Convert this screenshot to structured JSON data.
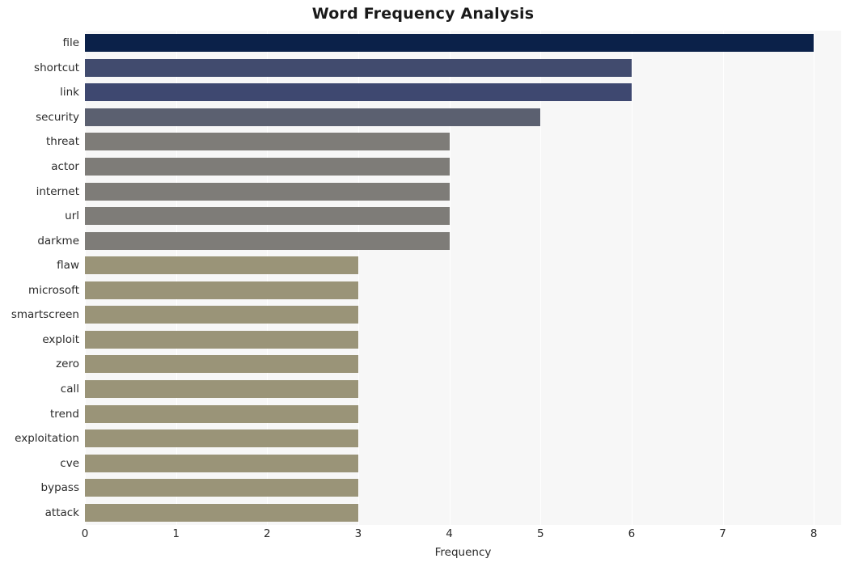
{
  "chart_data": {
    "type": "bar",
    "orientation": "horizontal",
    "title": "Word Frequency Analysis",
    "xlabel": "Frequency",
    "ylabel": "",
    "xlim": [
      0,
      8.3
    ],
    "xticks": [
      0,
      1,
      2,
      3,
      4,
      5,
      6,
      7,
      8
    ],
    "xticklabels": [
      "0",
      "1",
      "2",
      "3",
      "4",
      "5",
      "6",
      "7",
      "8"
    ],
    "grid": "vertical-white-on-light-gray",
    "legend": "none",
    "categories": [
      "file",
      "shortcut",
      "link",
      "security",
      "threat",
      "actor",
      "internet",
      "url",
      "darkme",
      "flaw",
      "microsoft",
      "smartscreen",
      "exploit",
      "zero",
      "call",
      "trend",
      "exploitation",
      "cve",
      "bypass",
      "attack"
    ],
    "values": [
      8,
      6,
      6,
      5,
      4,
      4,
      4,
      4,
      4,
      3,
      3,
      3,
      3,
      3,
      3,
      3,
      3,
      3,
      3,
      3
    ],
    "bar_colors": [
      "#0b2149",
      "#414b6e",
      "#3e4870",
      "#5b6070",
      "#7e7c78",
      "#7e7c78",
      "#7e7c78",
      "#7e7c78",
      "#7e7c78",
      "#9a9478",
      "#9a9478",
      "#9a9478",
      "#9a9478",
      "#9a9478",
      "#9a9478",
      "#9a9478",
      "#9a9478",
      "#9a9478",
      "#9a9478",
      "#9a9478"
    ],
    "plot_background": "#f7f7f7",
    "figure_background": "#ffffff"
  }
}
